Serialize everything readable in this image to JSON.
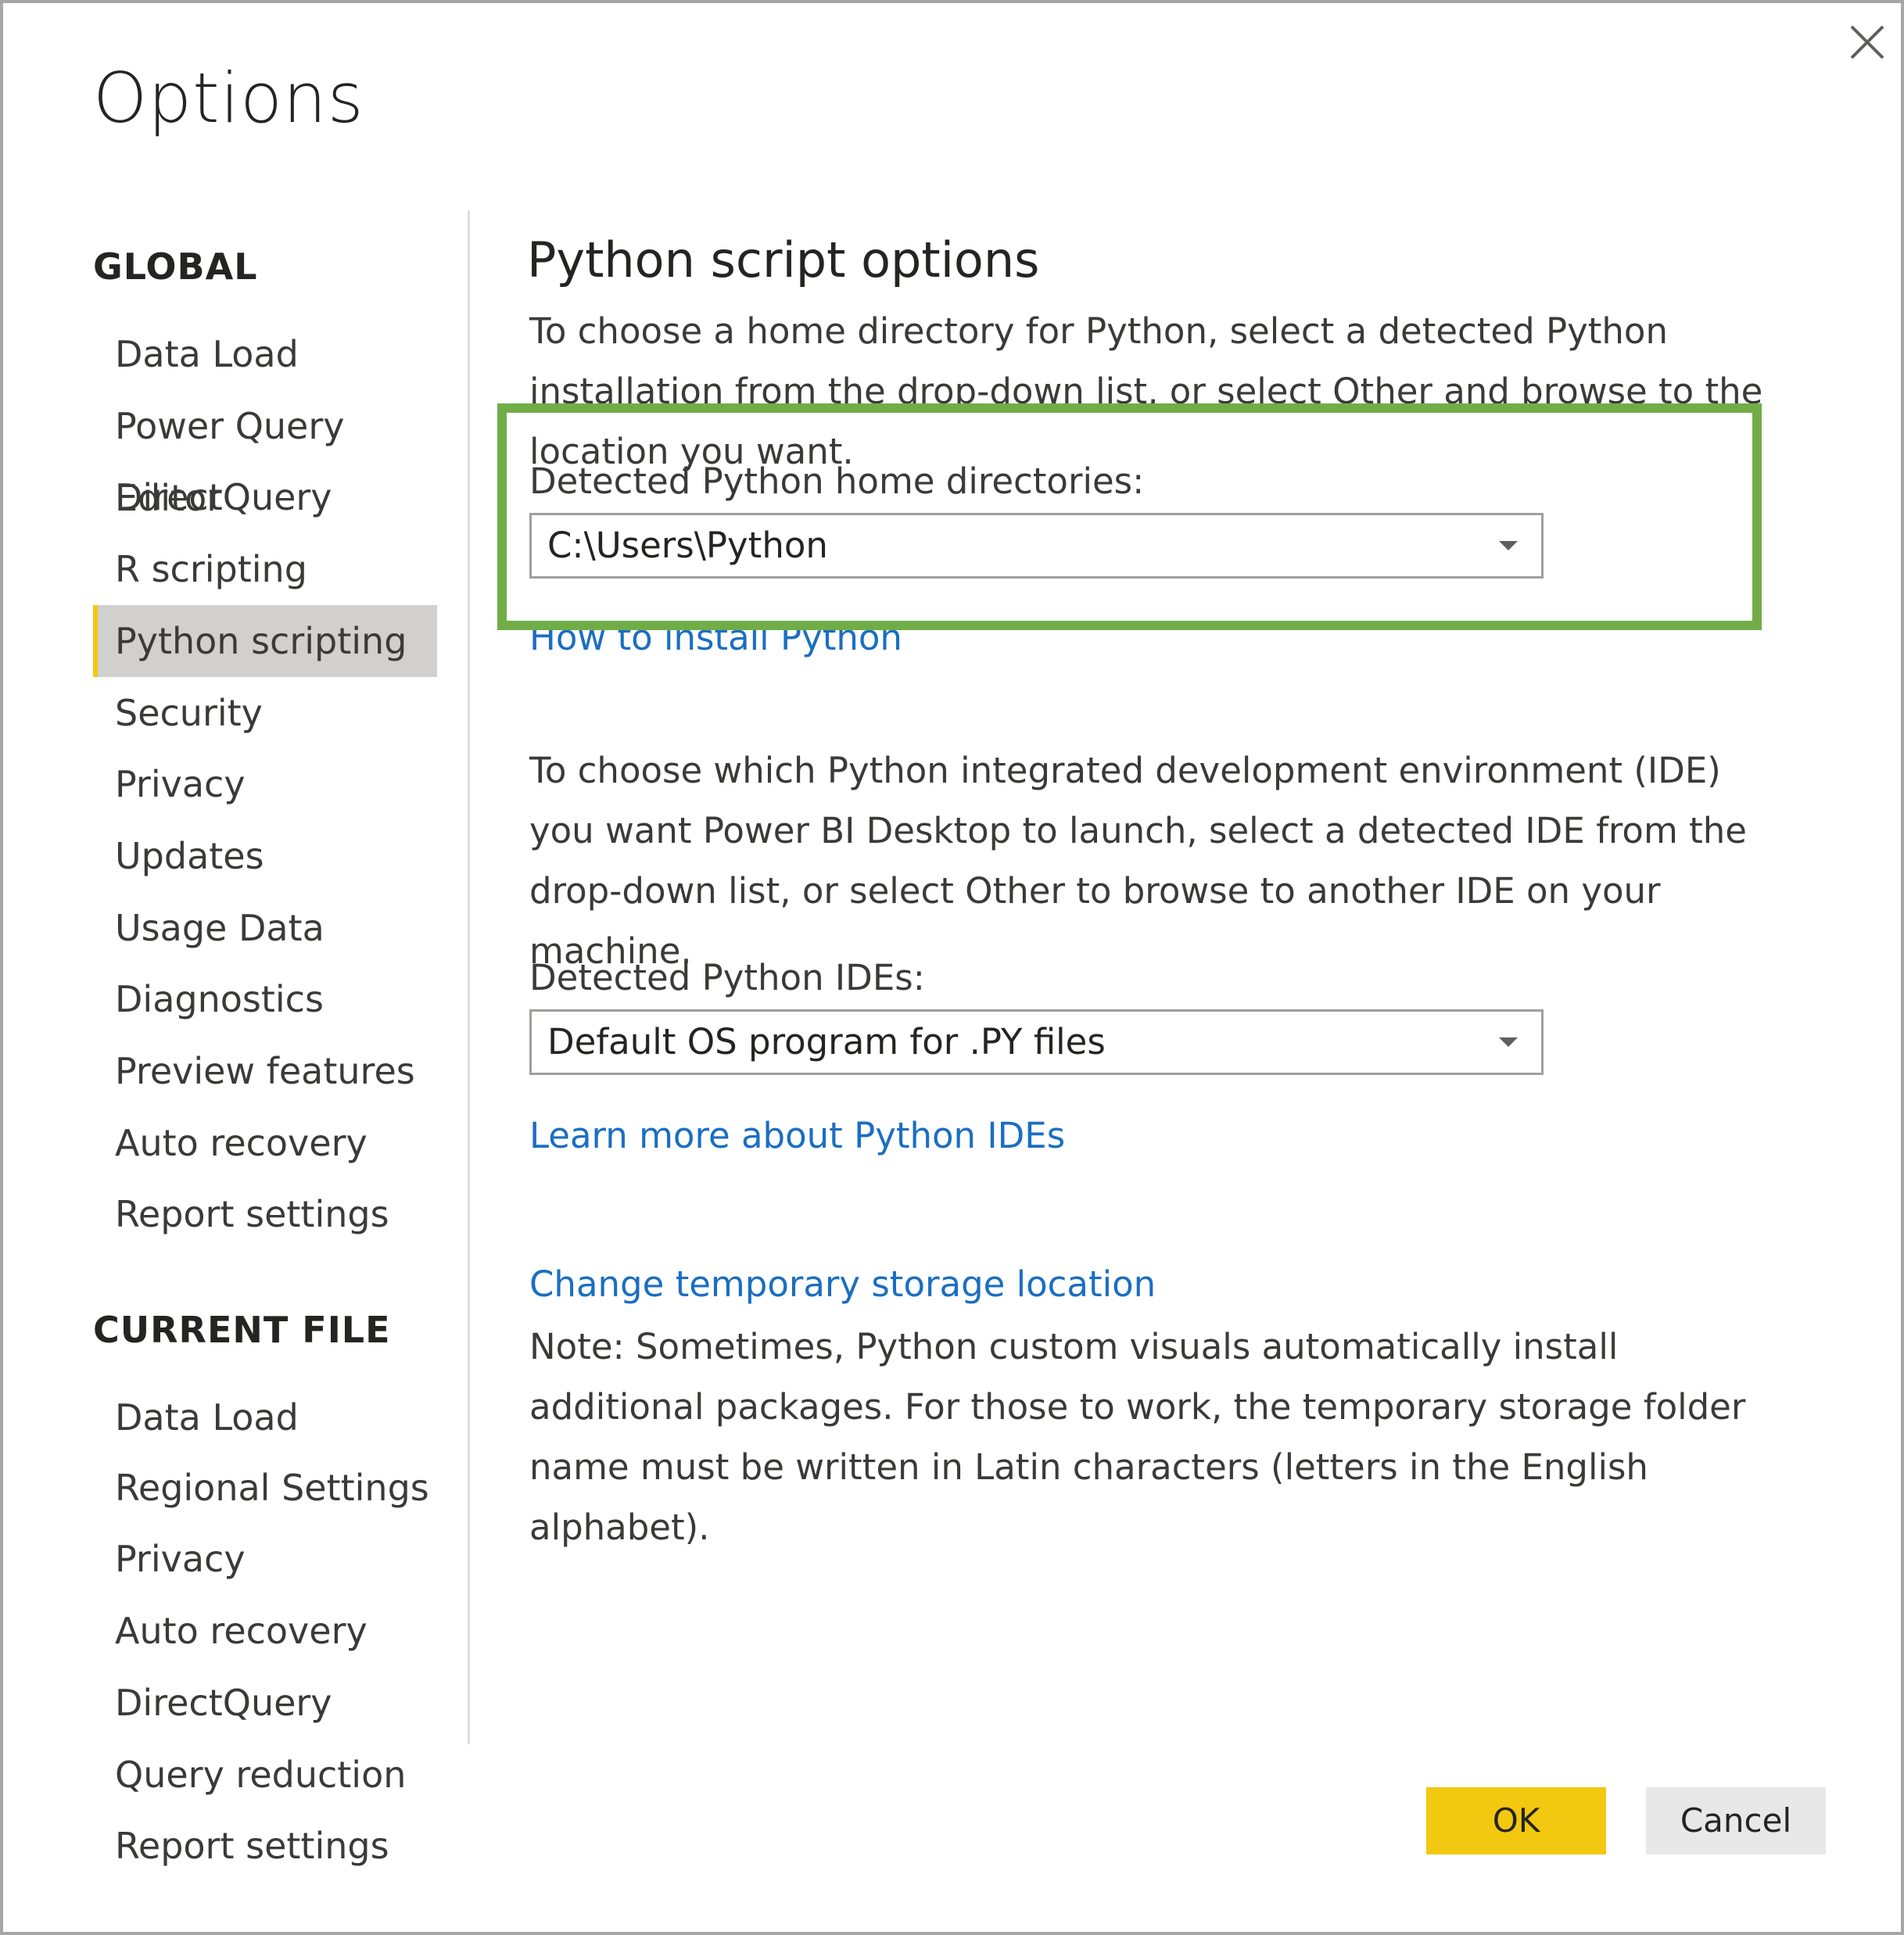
{
  "dialog": {
    "title": "Options",
    "close_icon": "close-icon"
  },
  "sidebar": {
    "global_heading": "GLOBAL",
    "global_items": [
      {
        "label": "Data Load"
      },
      {
        "label": "Power Query Editor"
      },
      {
        "label": "DirectQuery"
      },
      {
        "label": "R scripting"
      },
      {
        "label": "Python scripting",
        "selected": true
      },
      {
        "label": "Security"
      },
      {
        "label": "Privacy"
      },
      {
        "label": "Updates"
      },
      {
        "label": "Usage Data"
      },
      {
        "label": "Diagnostics"
      },
      {
        "label": "Preview features"
      },
      {
        "label": "Auto recovery"
      },
      {
        "label": "Report settings"
      }
    ],
    "current_heading": "CURRENT FILE",
    "current_items": [
      {
        "label": "Data Load"
      },
      {
        "label": "Regional Settings"
      },
      {
        "label": "Privacy"
      },
      {
        "label": "Auto recovery"
      },
      {
        "label": "DirectQuery"
      },
      {
        "label": "Query reduction"
      },
      {
        "label": "Report settings"
      }
    ]
  },
  "main": {
    "title": "Python script options",
    "home_intro": "To choose a home directory for Python, select a detected Python installation from the drop-down list, or select Other and browse to the location you want.",
    "home_label": "Detected Python home directories:",
    "home_value": "C:\\Users\\Python",
    "install_link": "How to install Python",
    "ide_intro": "To choose which Python integrated development environment (IDE) you want Power BI Desktop to launch, select a detected IDE from the drop-down list, or select Other to browse to another IDE on your machine.",
    "ide_label": "Detected Python IDEs:",
    "ide_value": "Default OS program for .PY files",
    "ide_link": "Learn more about Python IDEs",
    "storage_link": "Change temporary storage location",
    "storage_note": "Note: Sometimes, Python custom visuals automatically install additional packages. For those to work, the temporary storage folder name must be written in Latin characters (letters in the English alphabet)."
  },
  "footer": {
    "ok_label": "OK",
    "cancel_label": "Cancel"
  },
  "colors": {
    "accent_yellow": "#f2c811",
    "highlight_green": "#70ad47",
    "link_blue": "#1b6ec2",
    "selected_bg": "#d2d0ce"
  }
}
